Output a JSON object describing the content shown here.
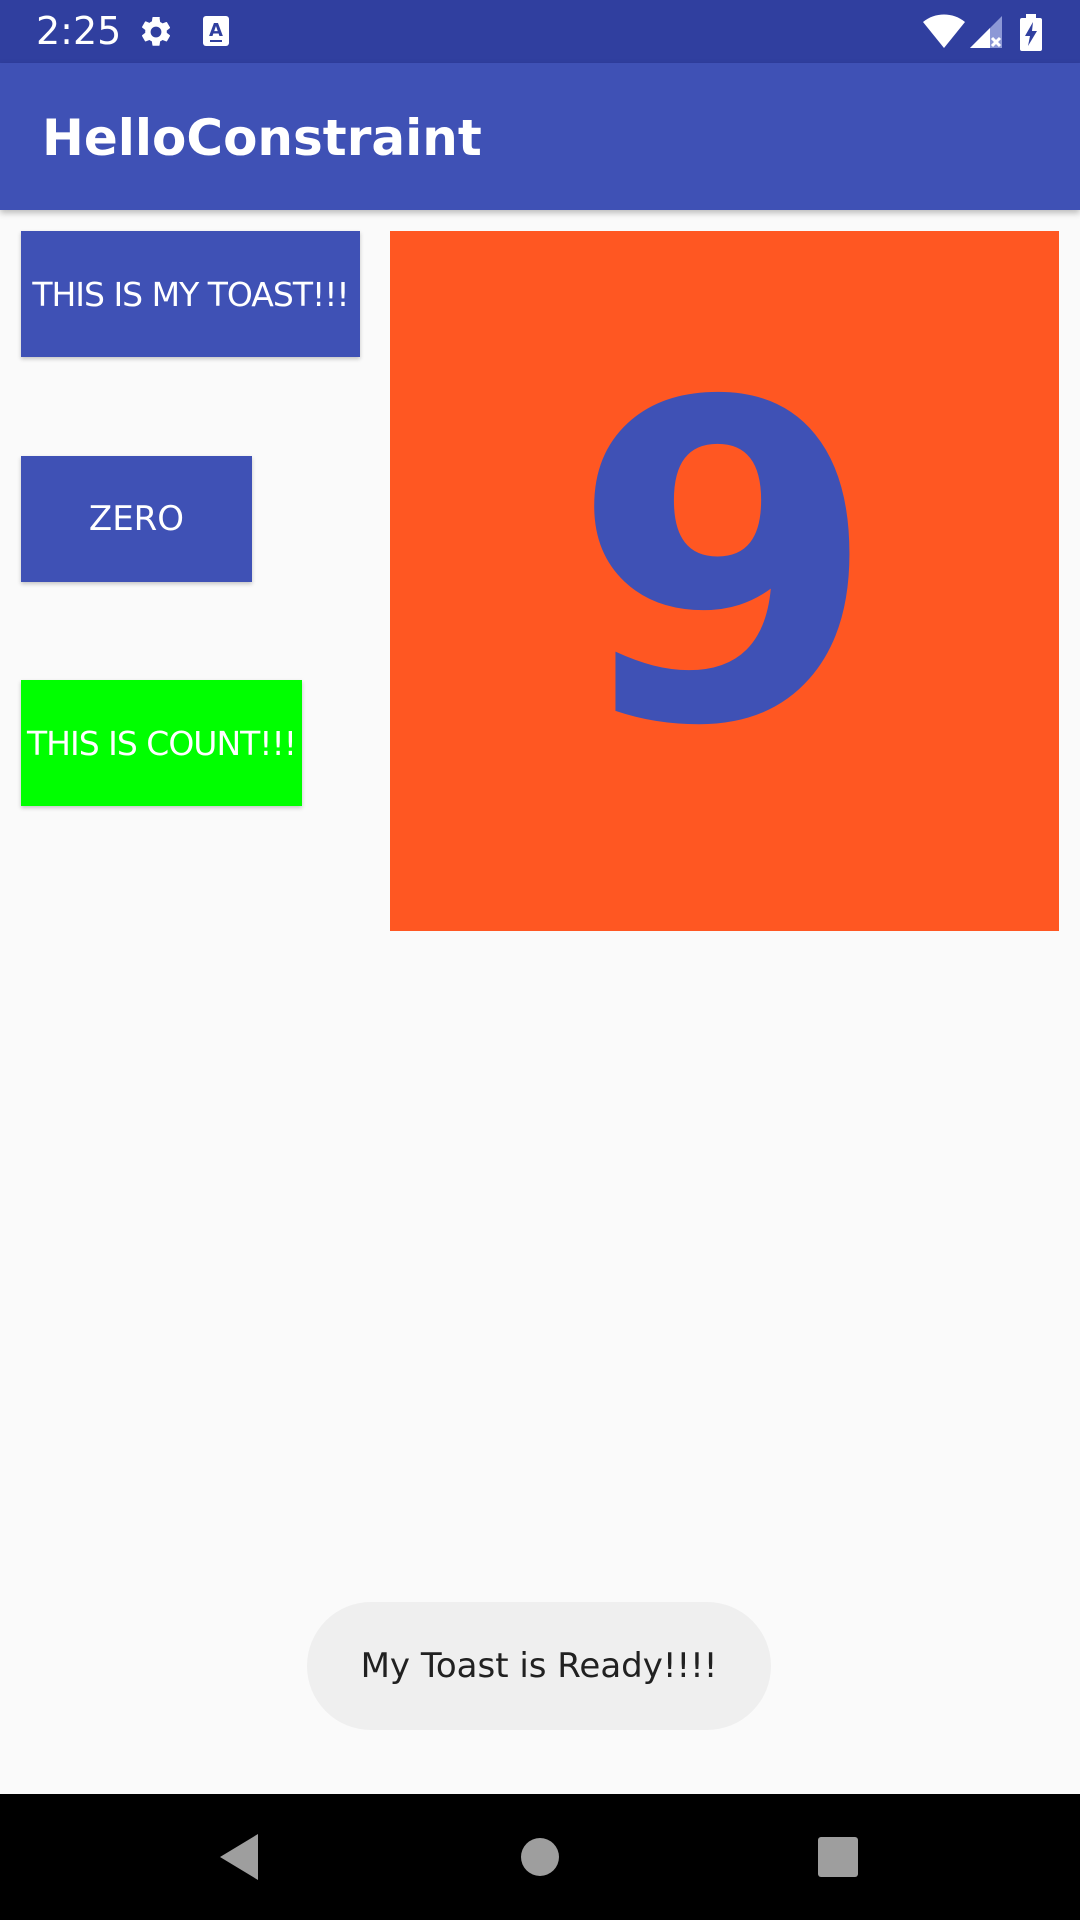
{
  "status_bar": {
    "time": "2:25",
    "background_color": "#303f9f",
    "icons": [
      "gear-icon",
      "keyboard-a-icon",
      "wifi-icon",
      "signal-icon",
      "battery-charging-icon"
    ]
  },
  "app_bar": {
    "title": "HelloConstraint",
    "background_color": "#3f51b5"
  },
  "buttons": {
    "toast_label": "THIS IS MY TOAST!!!",
    "zero_label": "ZERO",
    "count_label": "THIS IS COUNT!!!"
  },
  "count_display": {
    "value": "9",
    "background_color": "#ff5722",
    "text_color": "#3f51b5"
  },
  "toast": {
    "message": "My Toast is Ready!!!!"
  },
  "colors": {
    "primary": "#3f51b5",
    "primary_dark": "#303f9f",
    "count_button": "#00ff00",
    "accent": "#ff5722"
  },
  "nav_bar": {
    "icons": [
      "back-icon",
      "home-icon",
      "recents-icon"
    ]
  }
}
